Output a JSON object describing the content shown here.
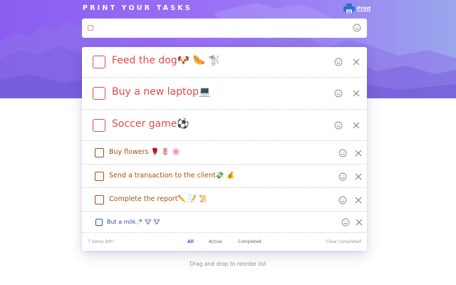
{
  "header": {
    "title": "PRINT YOUR TASKS",
    "print_label": "Print"
  },
  "new_task": {
    "value": "",
    "placeholder": ""
  },
  "todos": [
    {
      "text": "Feed the dog🐶 🌭 🐩",
      "completed": false
    },
    {
      "text": "Buy a new laptop💻",
      "completed": false
    },
    {
      "text": "Soccer game⚽",
      "completed": false
    },
    {
      "text": "Buy flowers 🌹 🌷 🌸",
      "completed": false
    },
    {
      "text": "Send a transaction to the client💸 💰",
      "completed": false
    },
    {
      "text": "Complete the report✏️ 📝 📜",
      "completed": false
    },
    {
      "text": "But a milk🍼 🐮 🐮",
      "completed": false
    }
  ],
  "footer": {
    "items_left": "7 items left!",
    "filters": [
      "All",
      "Active",
      "Completed"
    ],
    "active_filter": "All",
    "clear_completed": "Clear completed"
  },
  "hint": "Drag and drop to reorder list",
  "colors": {
    "large_item": "#e5484d",
    "small_item": "#a14f16",
    "last_item": "#3a4f9c",
    "active_filter": "#3b5bdb",
    "print_icon": "#2f6fd1"
  },
  "icons": {
    "print": "printer-icon",
    "emoji": "smiley-face-icon",
    "delete": "close-icon",
    "checkbox": "checkbox-icon"
  }
}
